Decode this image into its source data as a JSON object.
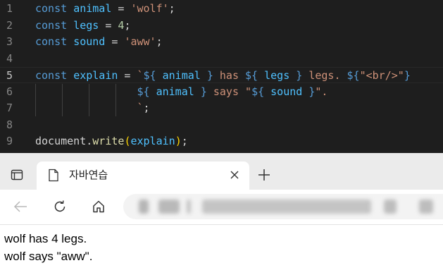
{
  "editor": {
    "lines": [
      {
        "n": "1",
        "tokens": [
          {
            "c": "kw",
            "t": "const "
          },
          {
            "c": "var",
            "t": "animal"
          },
          {
            "c": "op",
            "t": " = "
          },
          {
            "c": "str",
            "t": "'wolf'"
          },
          {
            "c": "op",
            "t": ";"
          }
        ]
      },
      {
        "n": "2",
        "tokens": [
          {
            "c": "kw",
            "t": "const "
          },
          {
            "c": "var",
            "t": "legs"
          },
          {
            "c": "op",
            "t": " = "
          },
          {
            "c": "num",
            "t": "4"
          },
          {
            "c": "op",
            "t": ";"
          }
        ]
      },
      {
        "n": "3",
        "tokens": [
          {
            "c": "kw",
            "t": "const "
          },
          {
            "c": "var",
            "t": "sound"
          },
          {
            "c": "op",
            "t": " = "
          },
          {
            "c": "str",
            "t": "'aww'"
          },
          {
            "c": "op",
            "t": ";"
          }
        ]
      },
      {
        "n": "4",
        "tokens": []
      },
      {
        "n": "5",
        "tokens": [
          {
            "c": "kw",
            "t": "const "
          },
          {
            "c": "var",
            "t": "explain"
          },
          {
            "c": "op",
            "t": " = "
          },
          {
            "c": "str",
            "t": "`"
          },
          {
            "c": "tpl",
            "t": "${"
          },
          {
            "c": "var",
            "t": " animal "
          },
          {
            "c": "tpl",
            "t": "}"
          },
          {
            "c": "str",
            "t": " has "
          },
          {
            "c": "tpl",
            "t": "${"
          },
          {
            "c": "var",
            "t": " legs "
          },
          {
            "c": "tpl",
            "t": "}"
          },
          {
            "c": "str",
            "t": " legs. "
          },
          {
            "c": "tpl",
            "t": "${"
          },
          {
            "c": "str",
            "t": "\"<br/>\""
          },
          {
            "c": "tpl",
            "t": "}"
          }
        ]
      },
      {
        "n": "6",
        "tokens": [
          {
            "c": "op",
            "t": "                "
          },
          {
            "c": "tpl",
            "t": "${"
          },
          {
            "c": "var",
            "t": " animal "
          },
          {
            "c": "tpl",
            "t": "}"
          },
          {
            "c": "str",
            "t": " says \""
          },
          {
            "c": "tpl",
            "t": "${"
          },
          {
            "c": "var",
            "t": " sound "
          },
          {
            "c": "tpl",
            "t": "}"
          },
          {
            "c": "str",
            "t": "\"."
          }
        ]
      },
      {
        "n": "7",
        "tokens": [
          {
            "c": "op",
            "t": "                "
          },
          {
            "c": "str",
            "t": "`"
          },
          {
            "c": "op",
            "t": ";"
          }
        ]
      },
      {
        "n": "8",
        "tokens": []
      },
      {
        "n": "9",
        "tokens": [
          {
            "c": "op",
            "t": "document"
          },
          {
            "c": "op",
            "t": "."
          },
          {
            "c": "fn",
            "t": "write"
          },
          {
            "c": "br1",
            "t": "("
          },
          {
            "c": "var",
            "t": "explain"
          },
          {
            "c": "br1",
            "t": ")"
          },
          {
            "c": "op",
            "t": ";"
          }
        ]
      }
    ]
  },
  "browser": {
    "tab_title": "자바연습",
    "tab_icon": "page-icon",
    "close_icon": "close-icon",
    "new_tab_icon": "plus-icon",
    "sidebar_icon": "tab-actions-icon",
    "back_icon": "back-arrow-icon",
    "refresh_icon": "refresh-icon",
    "home_icon": "home-icon"
  },
  "page": {
    "lines": [
      "wolf has 4 legs.",
      "wolf says \"aww\"."
    ]
  },
  "colors": {
    "editor_bg": "#1e1e1e",
    "keyword": "#569cd6",
    "variable": "#4fc1ff",
    "string": "#ce9178",
    "number": "#b5cea8",
    "function": "#dcdcaa",
    "bracket": "#ffd700",
    "tabstrip_bg": "#ebebeb"
  }
}
